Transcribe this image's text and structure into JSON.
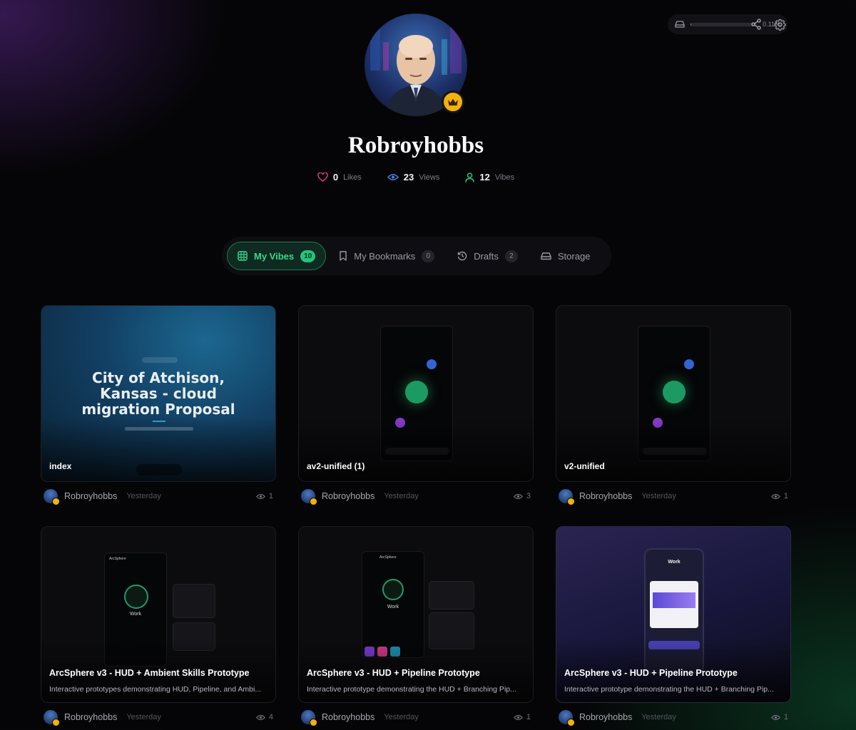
{
  "topbar": {
    "storage_percent": "0.11%",
    "storage_fraction": 0.0011,
    "icons": [
      "drive-icon",
      "share-icon",
      "gear-icon"
    ]
  },
  "profile": {
    "username": "Robroyhobbs",
    "badge_icon": "crown-icon",
    "stats": {
      "likes": {
        "value": "0",
        "label": "Likes"
      },
      "views": {
        "value": "23",
        "label": "Views"
      },
      "vibes": {
        "value": "12",
        "label": "Vibes"
      }
    }
  },
  "tabs": [
    {
      "label": "My Vibes",
      "count": "10",
      "icon": "grid-icon",
      "active": true
    },
    {
      "label": "My Bookmarks",
      "count": "0",
      "icon": "bookmark-icon",
      "active": false
    },
    {
      "label": "Drafts",
      "count": "2",
      "icon": "history-icon",
      "active": false
    },
    {
      "label": "Storage",
      "icon": "drive-icon",
      "active": false
    }
  ],
  "thumbnail_text": {
    "proposal_title_line1": "City of Atchison,",
    "proposal_title_line2": "Kansas - cloud",
    "proposal_title_line3": "migration Proposal",
    "work_label": "Work",
    "arcsphere_label": "ArcSphere"
  },
  "cards": [
    {
      "title": "index",
      "description": "",
      "author": "Robroyhobbs",
      "when": "Yesterday",
      "views": "1"
    },
    {
      "title": "av2-unified (1)",
      "description": "",
      "author": "Robroyhobbs",
      "when": "Yesterday",
      "views": "3"
    },
    {
      "title": "v2-unified",
      "description": "",
      "author": "Robroyhobbs",
      "when": "Yesterday",
      "views": "1"
    },
    {
      "title": "ArcSphere v3 - HUD + Ambient Skills Prototype",
      "description": "Interactive prototypes demonstrating HUD, Pipeline, and Ambi...",
      "author": "Robroyhobbs",
      "when": "Yesterday",
      "views": "4"
    },
    {
      "title": "ArcSphere v3 - HUD + Pipeline Prototype",
      "description": "Interactive prototype demonstrating the HUD + Branching Pip...",
      "author": "Robroyhobbs",
      "when": "Yesterday",
      "views": "1"
    },
    {
      "title": "ArcSphere v3 - HUD + Pipeline Prototype",
      "description": "Interactive prototype demonstrating the HUD + Branching Pip...",
      "author": "Robroyhobbs",
      "when": "Yesterday",
      "views": "1"
    }
  ],
  "colors": {
    "accent_green": "#24c47a",
    "like_pink": "#e0457b",
    "views_blue": "#4c7fe0",
    "vibes_green": "#2fc57e",
    "crown_gold": "#f2b20c"
  }
}
